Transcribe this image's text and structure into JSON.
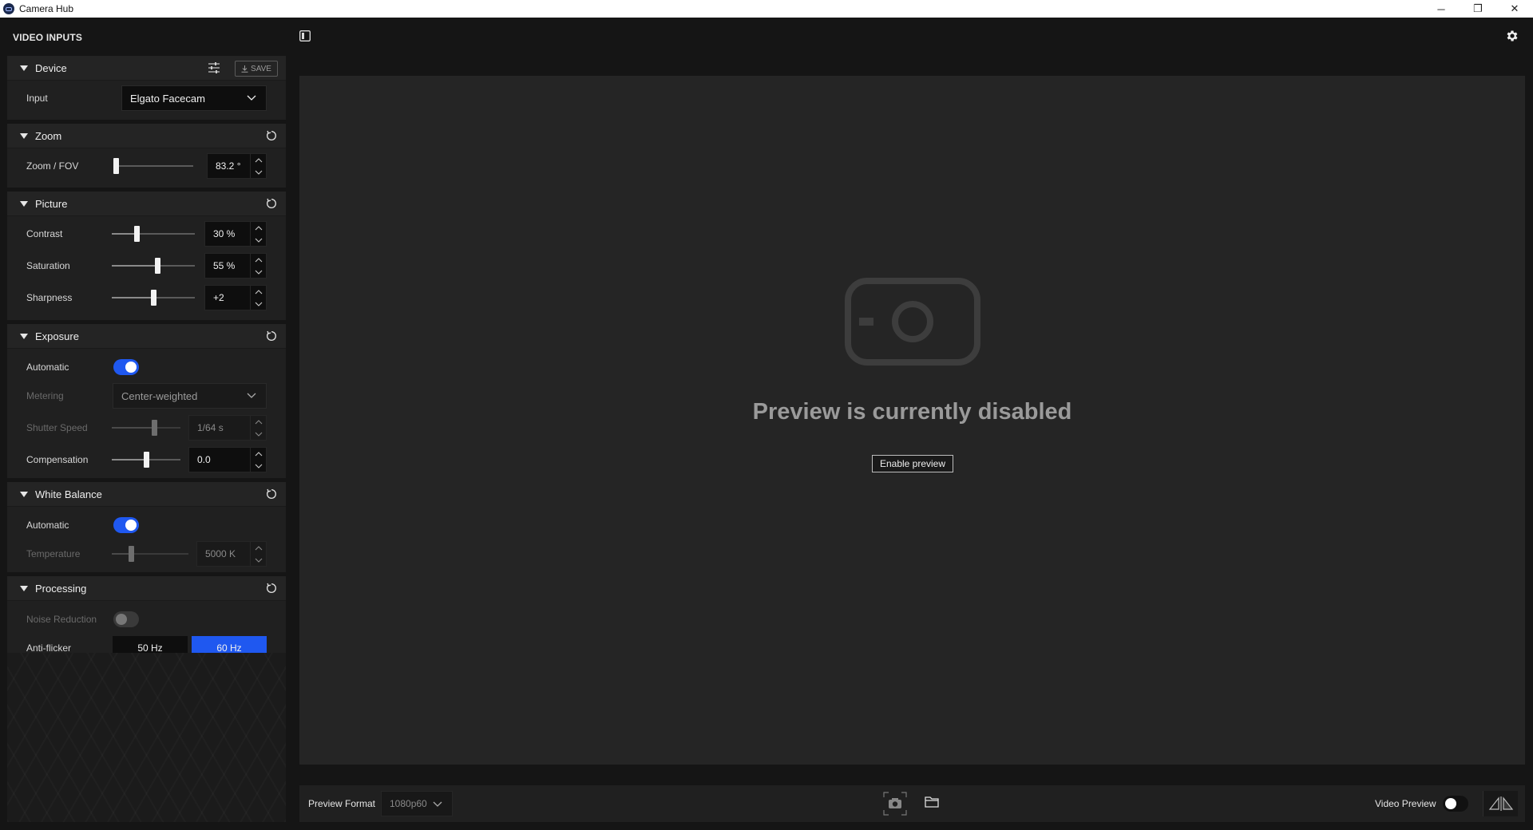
{
  "window": {
    "title": "Camera Hub",
    "minimize": "─",
    "restore": "❐",
    "close": "✕"
  },
  "sidebar": {
    "title": "VIDEO INPUTS",
    "device": {
      "title": "Device",
      "save_label": "SAVE",
      "input_label": "Input",
      "input_value": "Elgato Facecam"
    },
    "zoom": {
      "title": "Zoom",
      "label": "Zoom / FOV",
      "value": "83.2 °",
      "level": 0.0
    },
    "picture": {
      "title": "Picture",
      "contrast": {
        "label": "Contrast",
        "value": "30 %",
        "level": 0.3
      },
      "saturation": {
        "label": "Saturation",
        "value": "55 %",
        "level": 0.55
      },
      "sharpness": {
        "label": "Sharpness",
        "value": "+2",
        "level": 0.5
      }
    },
    "exposure": {
      "title": "Exposure",
      "automatic_label": "Automatic",
      "automatic_on": true,
      "metering_label": "Metering",
      "metering_value": "Center-weighted",
      "shutter_label": "Shutter Speed",
      "shutter_value": "1/64 s",
      "shutter_level": 0.62,
      "compensation_label": "Compensation",
      "compensation_value": "0.0",
      "compensation_level": 0.5
    },
    "white_balance": {
      "title": "White Balance",
      "automatic_label": "Automatic",
      "automatic_on": true,
      "temperature_label": "Temperature",
      "temperature_value": "5000 K",
      "temperature_level": 0.25
    },
    "processing": {
      "title": "Processing",
      "noise_label": "Noise Reduction",
      "noise_on": false,
      "antiflicker_label": "Anti-flicker",
      "options": [
        "50 Hz",
        "60 Hz"
      ],
      "selected": "60 Hz"
    }
  },
  "preview": {
    "message": "Preview is currently disabled",
    "enable_label": "Enable preview"
  },
  "bottom_bar": {
    "format_label": "Preview Format",
    "format_value": "1080p60",
    "video_preview_label": "Video Preview",
    "video_preview_on": false
  },
  "colors": {
    "accent": "#1f58f0",
    "panel": "#202020",
    "preview_bg": "#252525"
  }
}
